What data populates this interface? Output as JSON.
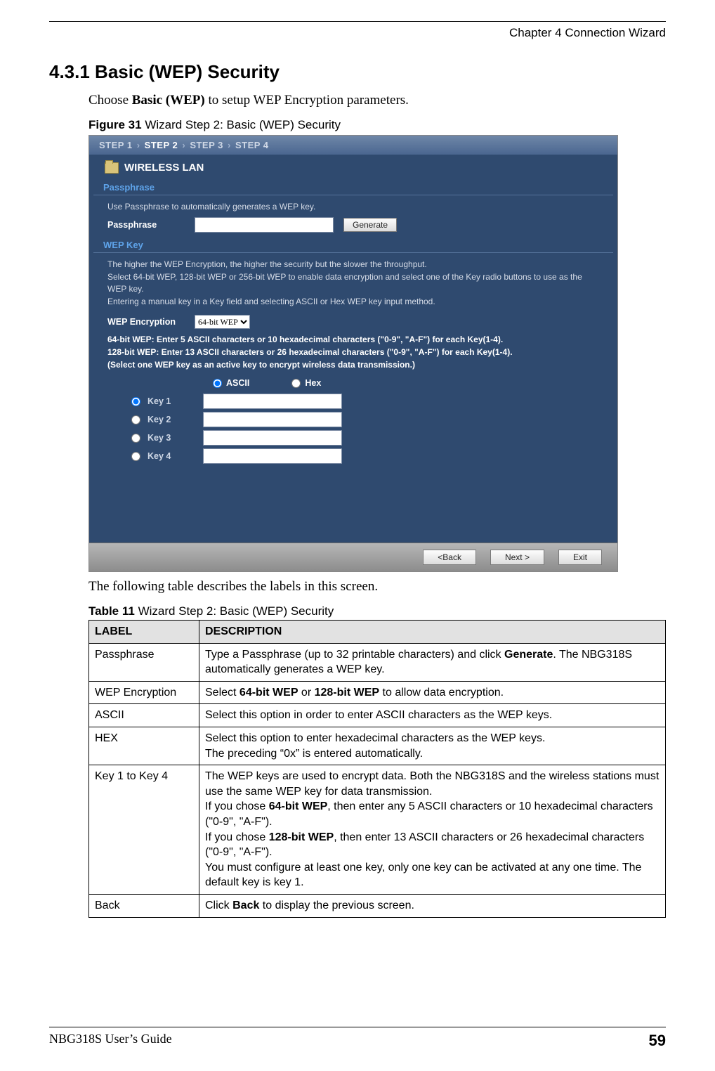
{
  "header": {
    "chapter": "Chapter 4 Connection Wizard"
  },
  "section": {
    "number_title": "4.3.1  Basic (WEP) Security",
    "intro_pre": "Choose ",
    "intro_bold": "Basic (WEP)",
    "intro_post": " to setup WEP Encryption parameters."
  },
  "figure": {
    "label": "Figure 31",
    "caption": "   Wizard Step 2: Basic (WEP) Security"
  },
  "wizard": {
    "steps": {
      "s1": "STEP 1",
      "s2": "STEP 2",
      "s3": "STEP 3",
      "s4": "STEP 4",
      "sep": "›"
    },
    "wlan_title": "WIRELESS LAN",
    "passphrase": {
      "header": "Passphrase",
      "note": "Use Passphrase to automatically generates a WEP key.",
      "label": "Passphrase",
      "value": "",
      "generate_btn": "Generate"
    },
    "wepkey": {
      "header": "WEP Key",
      "note1": "The higher the WEP Encryption, the higher the security but the slower the throughput.",
      "note2": "Select 64-bit WEP, 128-bit WEP or 256-bit WEP to enable data encryption and select one of the Key radio buttons to use as the WEP key.",
      "note3": "Entering a manual key in a Key field and selecting ASCII or Hex WEP key input method.",
      "enc_label": "WEP Encryption",
      "enc_value": "64-bit WEP",
      "hint1": "64-bit WEP: Enter 5 ASCII characters or 10 hexadecimal characters (\"0-9\", \"A-F\") for each Key(1-4).",
      "hint2": "128-bit WEP: Enter 13 ASCII characters or 26 hexadecimal characters (\"0-9\", \"A-F\") for each Key(1-4).",
      "hint3": "(Select one WEP key as an active key to encrypt wireless data transmission.)",
      "ascii": "ASCII",
      "hex": "Hex",
      "keys": {
        "k1": "Key 1",
        "k2": "Key 2",
        "k3": "Key 3",
        "k4": "Key 4"
      }
    },
    "buttons": {
      "back": "<Back",
      "next": "Next >",
      "exit": "Exit"
    }
  },
  "after_figure": "The following table describes the labels in this screen.",
  "table": {
    "label": "Table 11",
    "caption": "   Wizard Step 2: Basic (WEP) Security",
    "head": {
      "c1": "LABEL",
      "c2": "DESCRIPTION"
    },
    "rows": {
      "passphrase": {
        "label": "Passphrase",
        "d1": "Type a Passphrase (up to 32 printable characters) and click ",
        "d_bold": "Generate",
        "d2": ". The NBG318S automatically generates a WEP key."
      },
      "wep": {
        "label": "WEP Encryption",
        "d1": "Select ",
        "b1": "64-bit WEP",
        "d2": " or ",
        "b2": "128-bit WEP",
        "d3": " to allow data encryption."
      },
      "ascii": {
        "label": "ASCII",
        "desc": "Select this option in order to enter ASCII characters as the WEP keys."
      },
      "hex": {
        "label": "HEX",
        "l1": "Select this option to enter hexadecimal characters as the WEP keys.",
        "l2": "The preceding “0x” is entered automatically."
      },
      "keys": {
        "label": "Key 1 to Key 4",
        "l1": "The WEP keys are used to encrypt data. Both the NBG318S and the wireless stations must use the same WEP key for data transmission.",
        "l2a": "If you chose ",
        "l2b": "64-bit WEP",
        "l2c": ", then enter any 5 ASCII characters or 10 hexadecimal characters (\"0-9\", \"A-F\").",
        "l3a": "If you chose ",
        "l3b": "128-bit WEP",
        "l3c": ", then enter 13 ASCII characters or 26 hexadecimal characters   (\"0-9\", \"A-F\").",
        "l4": "You must configure at least one key, only one key can be activated at any one time. The default key is key 1."
      },
      "back": {
        "label": "Back",
        "d1": "Click ",
        "b1": "Back",
        "d2": " to display the previous screen."
      }
    }
  },
  "footer": {
    "guide": "NBG318S User’s Guide",
    "page": "59"
  }
}
